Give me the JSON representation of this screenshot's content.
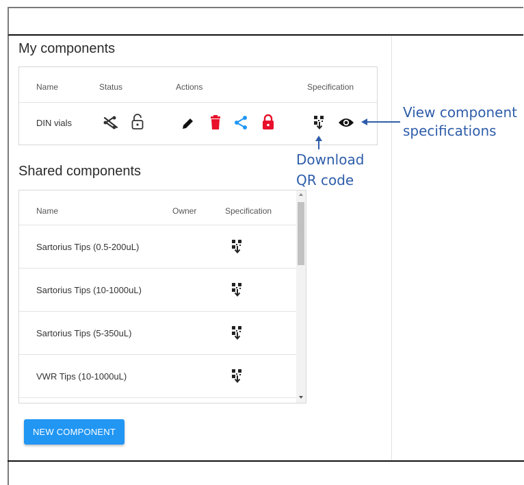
{
  "my_components": {
    "title": "My components",
    "headers": {
      "name": "Name",
      "status": "Status",
      "actions": "Actions",
      "specification": "Specification"
    },
    "rows": [
      {
        "name": "DIN vials"
      }
    ]
  },
  "shared_components": {
    "title": "Shared components",
    "headers": {
      "name": "Name",
      "owner": "Owner",
      "specification": "Specification"
    },
    "rows": [
      {
        "name": "Sartorius Tips (0.5-200uL)",
        "owner": ""
      },
      {
        "name": "Sartorius Tips (10-1000uL)",
        "owner": ""
      },
      {
        "name": "Sartorius Tips (5-350uL)",
        "owner": ""
      },
      {
        "name": "VWR Tips (10-1000uL)",
        "owner": ""
      }
    ]
  },
  "new_component_button": "NEW COMPONENT",
  "annotations": {
    "view_line1": "View component",
    "view_line2": "specifications",
    "qr_line1": "Download",
    "qr_line2": "QR code"
  },
  "colors": {
    "accent": "#2196f3",
    "delete": "#e8102b",
    "share": "#2196f3",
    "lock": "#e8102b",
    "annotation": "#2e5da9"
  },
  "icons": [
    "share-off-icon",
    "lock-open-icon",
    "pencil-icon",
    "trash-icon",
    "share-icon",
    "lock-icon",
    "qr-download-icon",
    "eye-icon"
  ]
}
